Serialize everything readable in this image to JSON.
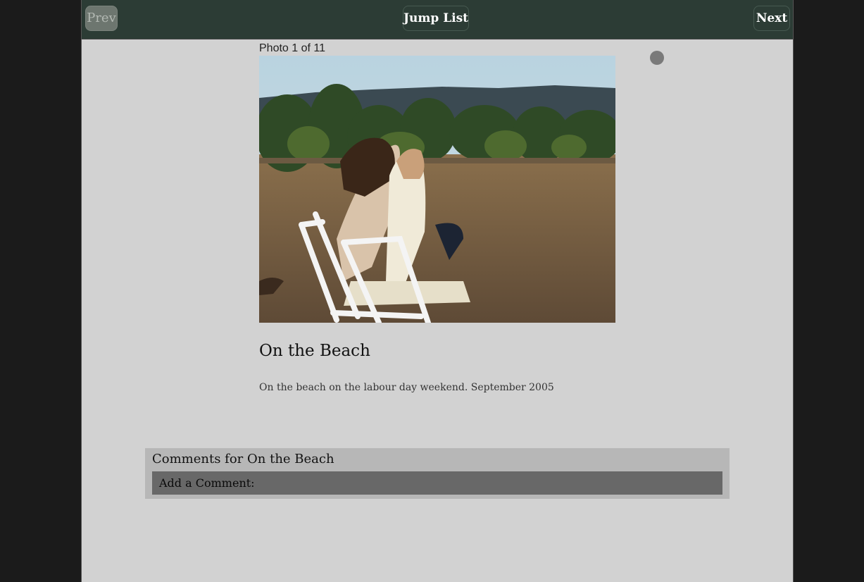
{
  "nav": {
    "prev_label": "Prev",
    "jump_label": "Jump List",
    "next_label": "Next"
  },
  "photo": {
    "counter": "Photo 1 of 11",
    "title": "On the Beach",
    "description": "On the beach on the labour day weekend. September 2005"
  },
  "comments": {
    "heading": "Comments for On the Beach",
    "add_label": "Add a Comment:"
  },
  "colors": {
    "topbar": "#2c3c35",
    "page_bg": "#d2d2d2",
    "outer_bg": "#1b1b1b",
    "comments_bg": "#b7b7b7",
    "add_comment_bg": "#686868"
  }
}
